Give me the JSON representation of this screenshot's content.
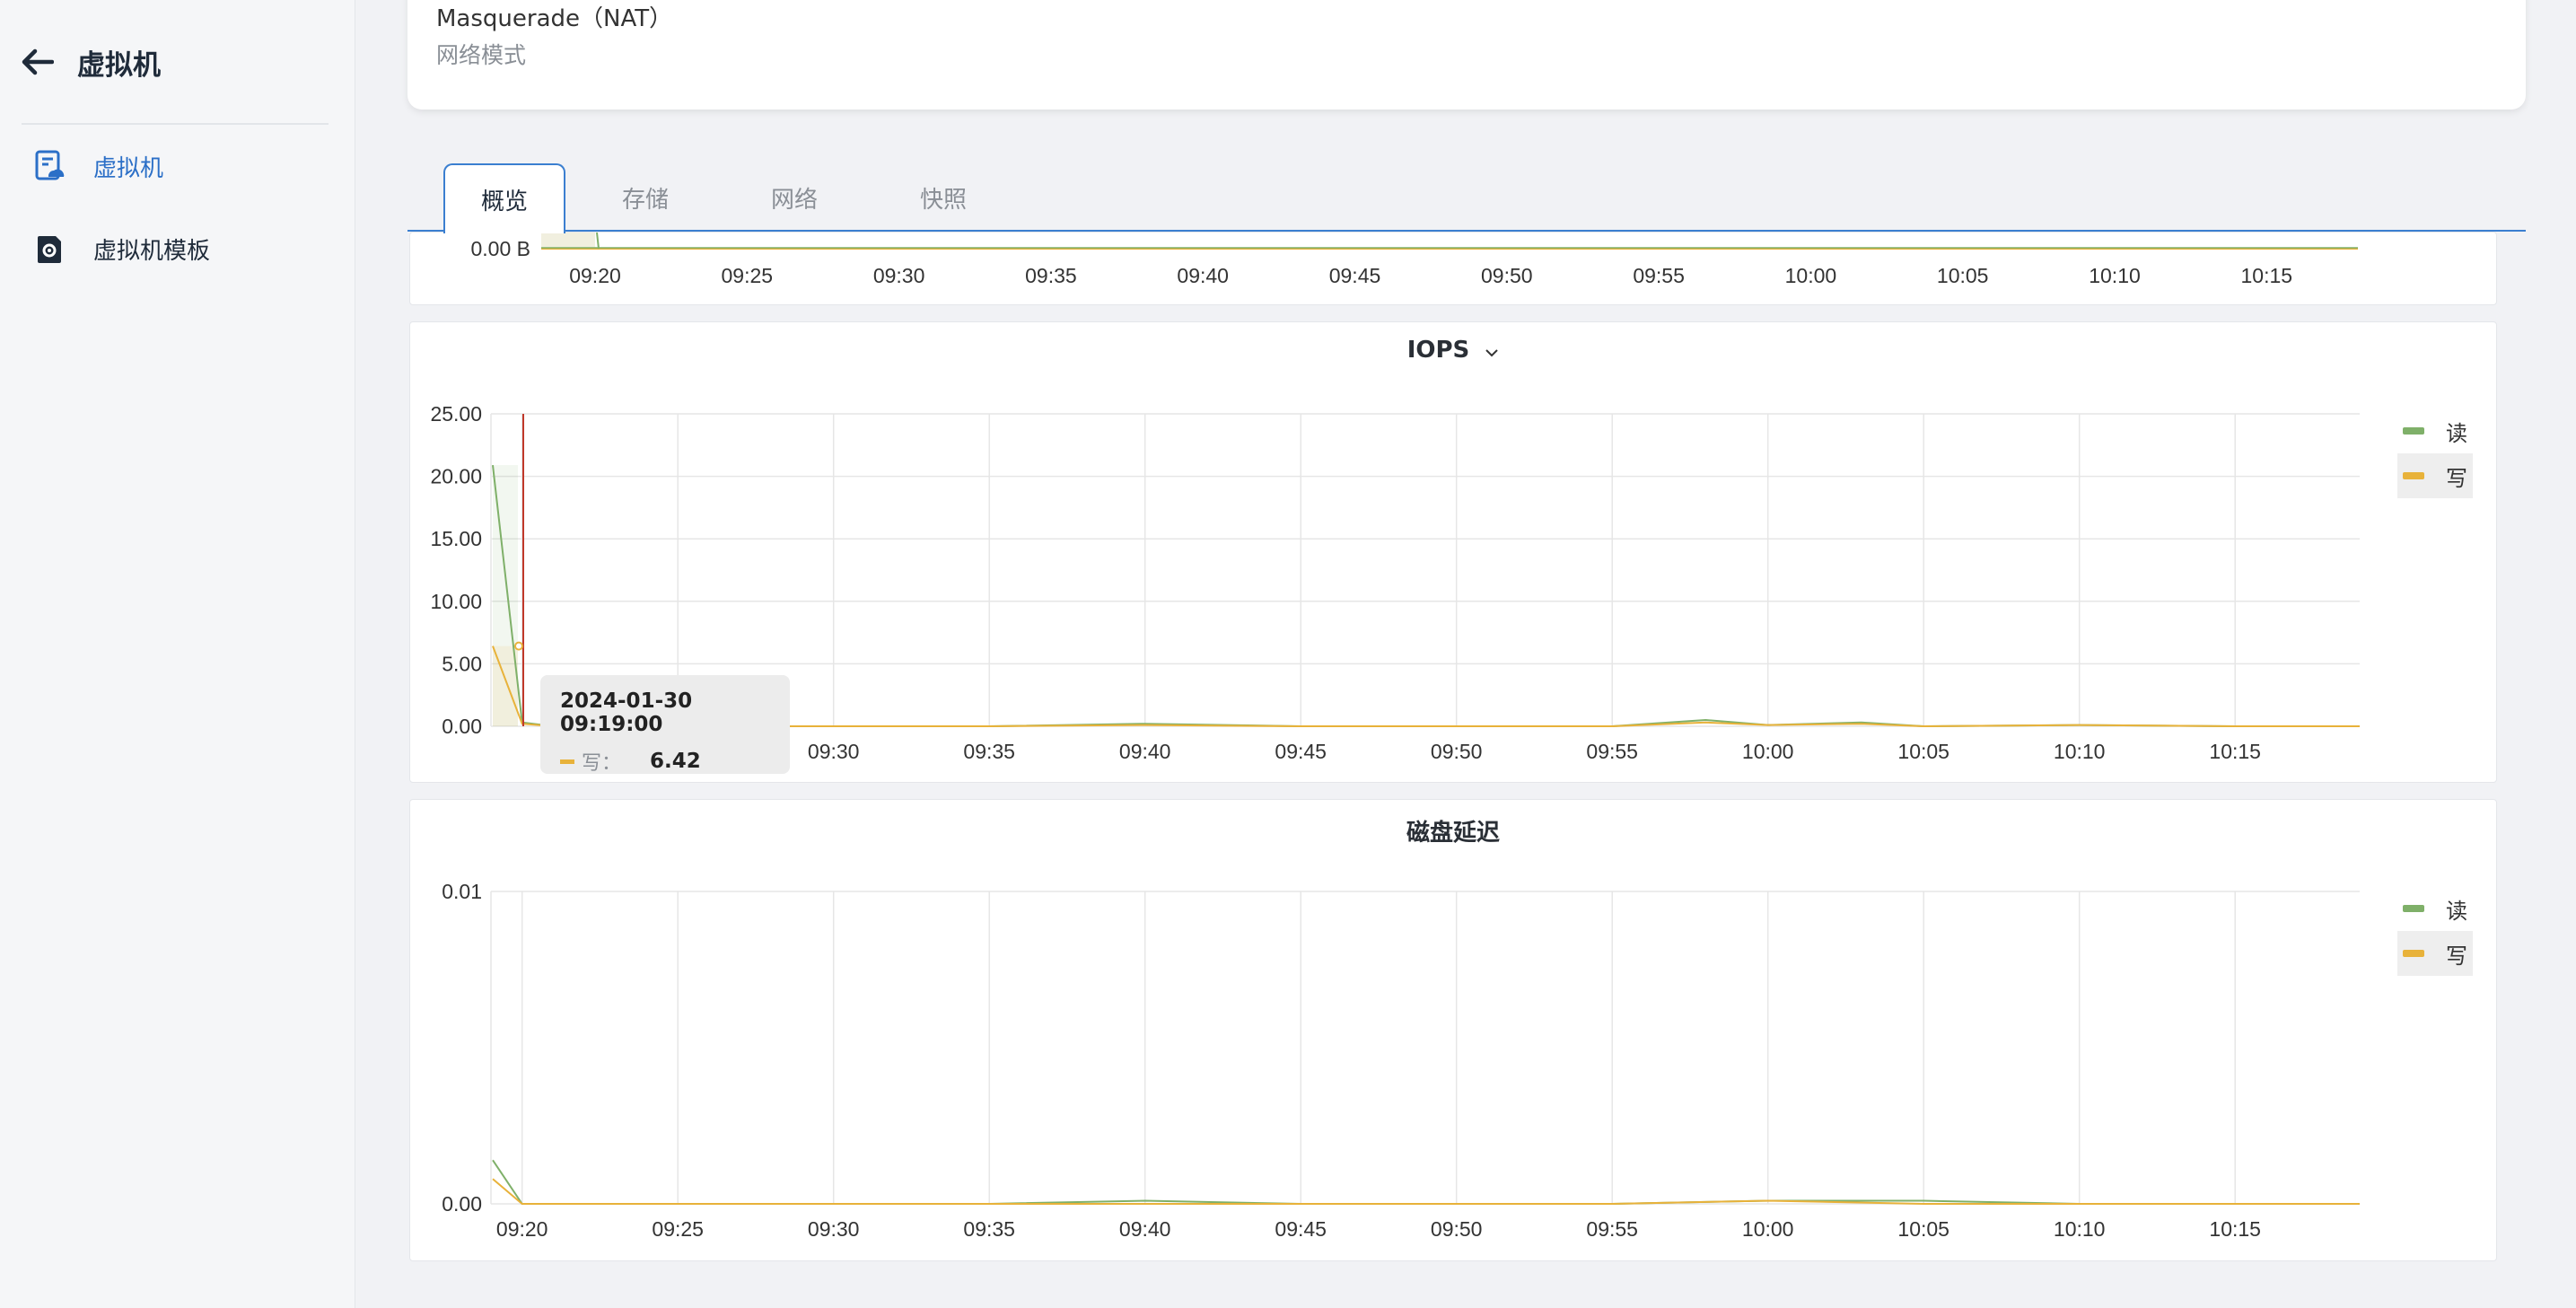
{
  "sidebar": {
    "title": "虚拟机",
    "items": [
      {
        "label": "虚拟机",
        "icon": "vm-icon",
        "active": true
      },
      {
        "label": "虚拟机模板",
        "icon": "vm-template-icon",
        "active": false
      }
    ]
  },
  "network_card": {
    "value": "Masquerade（NAT）",
    "label": "网络模式"
  },
  "tabs": [
    "概览",
    "存储",
    "网络",
    "快照"
  ],
  "active_tab": "概览",
  "colors": {
    "read": "#7fb069",
    "write": "#e8b23a",
    "accent": "#3b7fd0",
    "crosshair": "#c0392b"
  },
  "charts": {
    "throughput_tail": {
      "y_tick": "0.00 B",
      "x_ticks": [
        "09:20",
        "09:25",
        "09:30",
        "09:35",
        "09:40",
        "09:45",
        "09:50",
        "09:55",
        "10:00",
        "10:05",
        "10:10",
        "10:15"
      ]
    },
    "iops": {
      "title": "IOPS",
      "y_ticks": [
        "25.00",
        "20.00",
        "15.00",
        "10.00",
        "5.00",
        "0.00"
      ],
      "x_ticks": [
        "09:20",
        "09:25",
        "09:30",
        "09:35",
        "09:40",
        "09:45",
        "09:50",
        "09:55",
        "10:00",
        "10:05",
        "10:10",
        "10:15"
      ],
      "legend": [
        "读",
        "写"
      ]
    },
    "latency": {
      "title": "磁盘延迟",
      "y_ticks": [
        "0.01",
        "0.00"
      ],
      "x_ticks": [
        "09:20",
        "09:25",
        "09:30",
        "09:35",
        "09:40",
        "09:45",
        "09:50",
        "09:55",
        "10:00",
        "10:05",
        "10:10",
        "10:15"
      ],
      "legend": [
        "读",
        "写"
      ]
    }
  },
  "chart_data": [
    {
      "type": "line",
      "title": "IOPS",
      "ylim": [
        0,
        25
      ],
      "x": [
        "09:19",
        "09:20",
        "09:21",
        "09:25",
        "09:30",
        "09:35",
        "09:40",
        "09:45",
        "09:50",
        "09:55",
        "09:58",
        "10:00",
        "10:03",
        "10:05",
        "10:10",
        "10:15",
        "10:19"
      ],
      "series": [
        {
          "name": "读",
          "values": [
            20.9,
            0.3,
            0,
            0,
            0,
            0,
            0.2,
            0,
            0,
            0,
            0.5,
            0.1,
            0.3,
            0,
            0.1,
            0,
            0
          ]
        },
        {
          "name": "写",
          "values": [
            6.42,
            0.2,
            0,
            0,
            0,
            0,
            0.1,
            0,
            0,
            0,
            0.3,
            0.1,
            0.2,
            0,
            0.1,
            0,
            0
          ]
        }
      ],
      "tooltip": {
        "time": "2024-01-30 09:19:00",
        "series": "写：",
        "value": "6.42"
      }
    },
    {
      "type": "line",
      "title": "磁盘延迟",
      "ylim": [
        0,
        0.01
      ],
      "x": [
        "09:19",
        "09:20",
        "09:25",
        "09:30",
        "09:35",
        "09:40",
        "09:45",
        "09:50",
        "09:55",
        "10:00",
        "10:05",
        "10:10",
        "10:15",
        "10:19"
      ],
      "series": [
        {
          "name": "读",
          "values": [
            0.0014,
            0,
            0,
            0,
            0,
            0.0001,
            0,
            0,
            0,
            0.0001,
            0.0001,
            0,
            0,
            0
          ]
        },
        {
          "name": "写",
          "values": [
            0.0008,
            0,
            0,
            0,
            0,
            0,
            0,
            0,
            0,
            0.0001,
            0,
            0,
            0,
            0
          ]
        }
      ]
    }
  ]
}
